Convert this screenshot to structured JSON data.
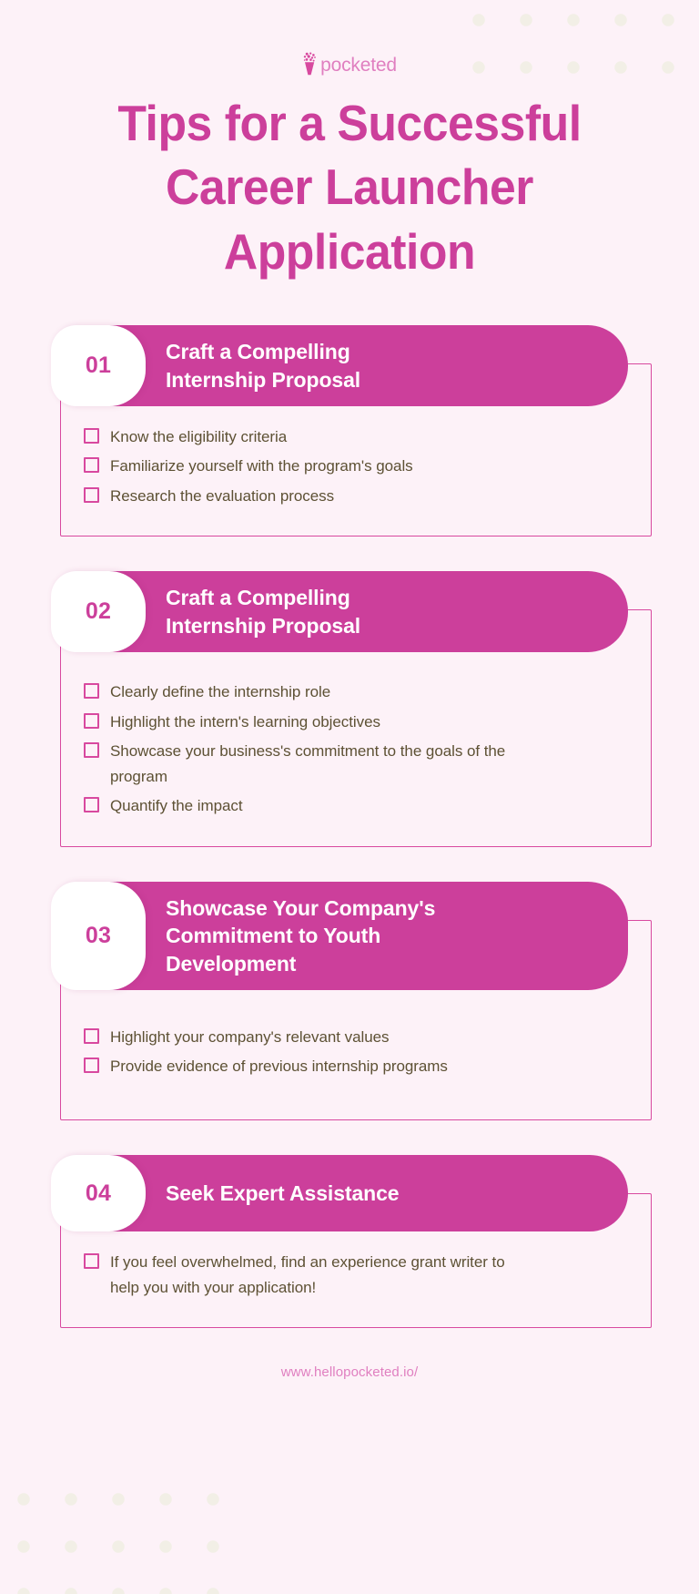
{
  "brand": {
    "logo_text": "pocketed",
    "logo_icon": "bouquet-icon",
    "accent": "#cc3f9b",
    "accent_light": "#e07fc0",
    "background": "#fdf2f8",
    "text_color": "#5d5134",
    "dot_color": "#f2efe6"
  },
  "title": "Tips for a Successful\nCareer Launcher\nApplication",
  "cards": [
    {
      "number": "01",
      "heading": "Craft a Compelling\nInternship Proposal",
      "items": [
        "Know the eligibility criteria",
        "Familiarize yourself with the program's goals",
        "Research the evaluation process"
      ]
    },
    {
      "number": "02",
      "heading": "Craft a Compelling\nInternship Proposal",
      "items": [
        "Clearly define the internship role",
        "Highlight the intern's learning objectives",
        "Showcase your business's commitment to the goals of the program",
        "Quantify the impact"
      ]
    },
    {
      "number": "03",
      "heading": "Showcase Your Company's\nCommitment to Youth\nDevelopment",
      "items": [
        "Highlight your company's relevant values",
        "Provide evidence of previous internship programs"
      ]
    },
    {
      "number": "04",
      "heading": "Seek Expert Assistance",
      "items": [
        "If you feel overwhelmed, find an experience grant writer to help you with your application!"
      ]
    }
  ],
  "footer": {
    "url": "www.hellopocketed.io/"
  }
}
